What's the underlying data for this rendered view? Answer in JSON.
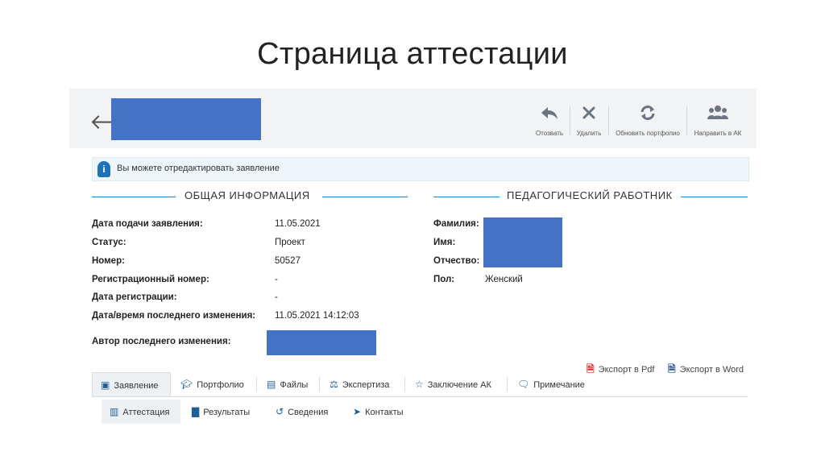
{
  "slide": {
    "title": "Страница аттестации"
  },
  "toolbar": {
    "back_icon": "arrow-left-icon",
    "buttons": [
      {
        "label": "Отозвать",
        "icon": "reply-icon"
      },
      {
        "label": "Удалить",
        "icon": "close-icon"
      },
      {
        "label": "Обновить портфолио",
        "icon": "refresh-icon"
      },
      {
        "label": "Направить в АК",
        "icon": "users-icon"
      }
    ]
  },
  "alert": {
    "text": "Вы можете отредактировать заявление",
    "icon": "info-icon"
  },
  "general": {
    "title": "ОБЩАЯ ИНФОРМАЦИЯ",
    "rows": [
      {
        "label": "Дата подачи заявления:",
        "value": "11.05.2021"
      },
      {
        "label": "Статус:",
        "value": "Проект"
      },
      {
        "label": "Номер:",
        "value": "50527"
      },
      {
        "label": "Регистрационный номер:",
        "value": "-"
      },
      {
        "label": "Дата регистрации:",
        "value": "-"
      },
      {
        "label": "Дата/время последнего изменения:",
        "value": "11.05.2021 14:12:03"
      },
      {
        "label": "Автор последнего изменения:",
        "value": ""
      }
    ]
  },
  "teacher": {
    "title": "ПЕДАГОГИЧЕСКИЙ РАБОТНИК",
    "rows": [
      {
        "label": "Фамилия:",
        "value": ""
      },
      {
        "label": "Имя:",
        "value": ""
      },
      {
        "label": "Отчество:",
        "value": ""
      },
      {
        "label": "Пол:",
        "value": "Женский"
      }
    ]
  },
  "export": {
    "pdf": "Экспорт в Pdf",
    "word": "Экспорт в Word"
  },
  "tabs": [
    {
      "label": "Заявление",
      "icon": "form-icon",
      "active": true
    },
    {
      "label": "Портфолио",
      "icon": "graduation-cap-icon"
    },
    {
      "label": "Файлы",
      "icon": "files-icon"
    },
    {
      "label": "Экспертиза",
      "icon": "balance-scale-icon"
    },
    {
      "label": "Заключение АК",
      "icon": "star-icon"
    },
    {
      "label": "Примечание",
      "icon": "comment-icon"
    }
  ],
  "subtabs": [
    {
      "label": "Аттестация",
      "icon": "map-icon",
      "active": true
    },
    {
      "label": "Результаты",
      "icon": "bar-chart-icon"
    },
    {
      "label": "Сведения",
      "icon": "history-icon"
    },
    {
      "label": "Контакты",
      "icon": "paper-plane-icon"
    }
  ],
  "colors": {
    "accent": "#2a7fc4",
    "redaction": "#4472c4",
    "toolbar_bg": "#f1f3f4",
    "alert_bg": "#eef5fb",
    "pdf_icon": "#d9302c",
    "word_icon": "#2b5797"
  }
}
